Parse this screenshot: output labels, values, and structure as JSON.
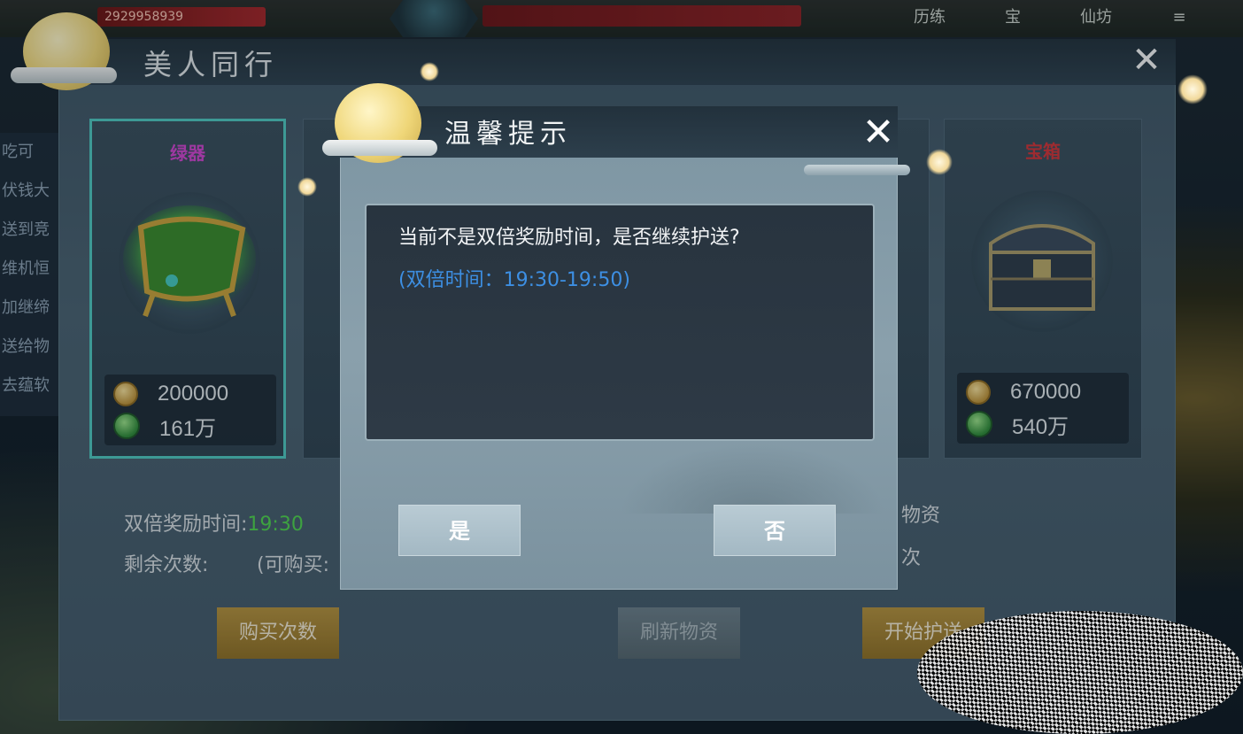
{
  "hud": {
    "hp_text": "2929958939",
    "buttons": [
      "历练",
      "宝",
      "仙坊"
    ]
  },
  "left_chat": [
    "吃可",
    "伏钱大",
    "送到竞",
    "维机恒",
    "加继缔",
    "送给物",
    "去蕴软"
  ],
  "main_panel": {
    "title": "美人同行",
    "close_glyph": "✕",
    "cards": [
      {
        "label": "绿器",
        "label_color": "#d046d0",
        "selected": true,
        "item": "green-cauldron",
        "coins": "200000",
        "jade": "161万"
      },
      {
        "label": "宝箱",
        "label_color": "#d0353a",
        "selected": false,
        "item": "iron-chest",
        "coins": "670000",
        "jade": "540万"
      }
    ],
    "double_time_label": "双倍奖励时间:",
    "double_time_value": "19:30",
    "remaining_label": "剩余次数:",
    "purchasable_label": "(可购买:",
    "right_text_1": "物资",
    "right_text_2": "次",
    "buttons": {
      "buy": "购买次数",
      "refresh": "刷新物资",
      "start": "开始护送"
    }
  },
  "dialog": {
    "title": "温馨提示",
    "close_glyph": "✕",
    "message": "当前不是双倍奖励时间，是否继续护送?",
    "hint": "(双倍时间：19:30-19:50)",
    "yes": "是",
    "no": "否"
  },
  "colors": {
    "hint_blue": "#3d8fe3",
    "selected_border": "#4fc7c0",
    "time_green": "#4fd34f"
  }
}
